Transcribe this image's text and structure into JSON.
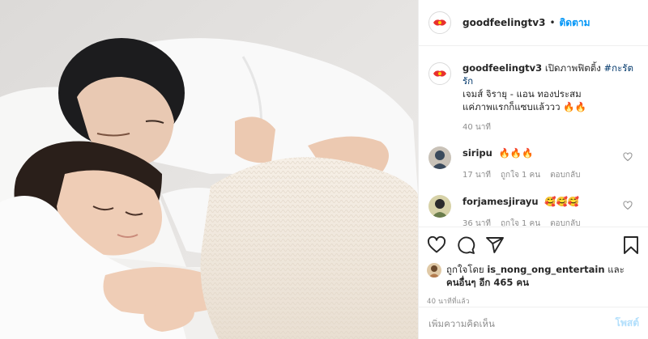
{
  "post": {
    "username": "goodfeelingtv3",
    "follow_label": "ติดตาม",
    "separator": "•",
    "avatar_icon": "goodfeeling-logo-icon",
    "caption": {
      "text_before": "เปิดภาพฟิตติ้ง ",
      "hashtag": "#กะรัตรัก",
      "line2": "เจมส์ จิรายุ - แอน ทองประสม",
      "line3": "แค่ภาพแรกก็แซบแล้ววว 🔥🔥",
      "time": "40 นาที"
    },
    "comments": [
      {
        "username": "siripu",
        "text": "🔥🔥🔥",
        "time": "17 นาที",
        "likes": "ถูกใจ 1 คน",
        "reply": "ตอบกลับ",
        "avatar_color": "#3a4a5c"
      },
      {
        "username": "forjamesjirayu",
        "text": "🥰🥰🥰",
        "time": "36 นาที",
        "likes": "ถูกใจ 1 คน",
        "reply": "ตอบกลับ",
        "avatar_color": "#6a7d4c"
      }
    ],
    "actions": {
      "like_icon": "heart-icon",
      "comment_icon": "comment-bubble-icon",
      "share_icon": "paper-plane-icon",
      "save_icon": "bookmark-icon"
    },
    "likes_summary": {
      "prefix": "ถูกใจโดย ",
      "liker": "is_nong_ong_entertain",
      "and": " และ",
      "others": "คนอื่นๆ อีก 465 คน"
    },
    "timestamp": "40 นาทีที่แล้ว",
    "add_comment": {
      "placeholder": "เพิ่มความคิดเห็น",
      "post_label": "โพสต์"
    }
  },
  "colors": {
    "accent": "#0095f6",
    "post_disabled": "#b2dffc",
    "muted": "#8e8e8e",
    "hashtag": "#00376b"
  }
}
